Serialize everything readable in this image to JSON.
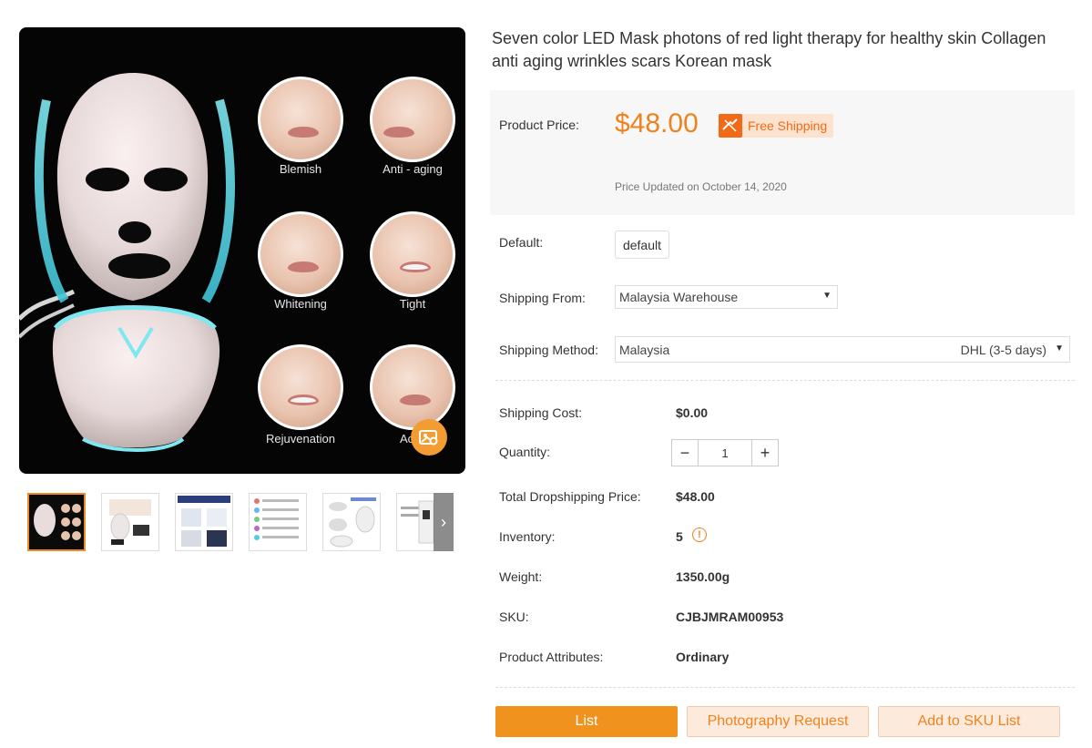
{
  "gallery": {
    "main_image": "led-face-mask-product-image",
    "circle_labels": [
      "Blemish",
      "Anti - aging",
      "Whitening",
      "Tight",
      "Rejuvenation",
      "Ac"
    ],
    "thumbnail_count": 6
  },
  "product": {
    "title": "Seven color LED Mask photons of red light therapy for healthy skin Collagen anti aging wrinkles scars Korean mask"
  },
  "price_box": {
    "label": "Product Price:",
    "price": "$48.00",
    "free_shipping": "Free Shipping",
    "updated": "Price Updated on October 14, 2020"
  },
  "options": {
    "default_label": "Default:",
    "default_value": "default",
    "shipping_from_label": "Shipping From:",
    "shipping_from_value": "Malaysia Warehouse",
    "shipping_method_label": "Shipping Method:",
    "shipping_method_country": "Malaysia",
    "shipping_method_value": "DHL (3-5 days)"
  },
  "details": {
    "shipping_cost_label": "Shipping Cost:",
    "shipping_cost": "$0.00",
    "quantity_label": "Quantity:",
    "quantity": "1",
    "total_label": "Total Dropshipping Price:",
    "total": "$48.00",
    "inventory_label": "Inventory:",
    "inventory": "5",
    "weight_label": "Weight:",
    "weight": "1350.00g",
    "sku_label": "SKU:",
    "sku": "CJBJMRAM00953",
    "attributes_label": "Product Attributes:",
    "attributes": "Ordinary"
  },
  "actions": {
    "list": "List",
    "photography": "Photography Request",
    "add_sku": "Add to SKU List"
  },
  "colors": {
    "accent": "#f0921e",
    "price": "#f0821e",
    "free_shipping_bg": "#fbe3cf"
  }
}
